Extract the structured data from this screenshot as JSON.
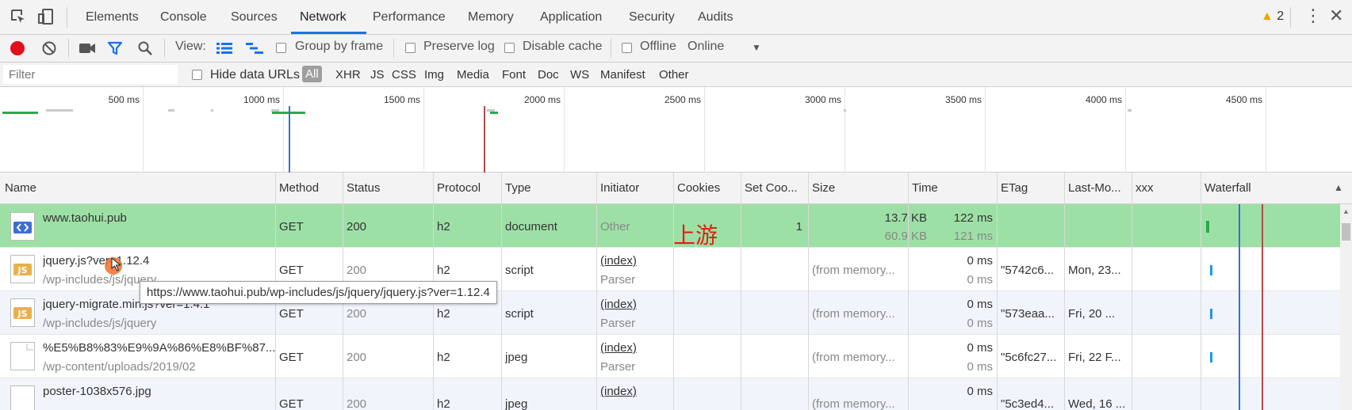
{
  "tabs": [
    "Elements",
    "Console",
    "Sources",
    "Network",
    "Performance",
    "Memory",
    "Application",
    "Security",
    "Audits"
  ],
  "active_tab": "Network",
  "warnings": {
    "count": "2"
  },
  "toolbar": {
    "view_label": "View:",
    "group_by_frame": "Group by frame",
    "preserve_log": "Preserve log",
    "disable_cache": "Disable cache",
    "offline": "Offline",
    "throttle": "Online"
  },
  "filter": {
    "placeholder": "Filter",
    "hide_data_urls": "Hide data URLs",
    "types": [
      "All",
      "XHR",
      "JS",
      "CSS",
      "Img",
      "Media",
      "Font",
      "Doc",
      "WS",
      "Manifest",
      "Other"
    ],
    "selected_type": "All"
  },
  "overview": {
    "ticks": [
      "500 ms",
      "1000 ms",
      "1500 ms",
      "2000 ms",
      "2500 ms",
      "3000 ms",
      "3500 ms",
      "4000 ms",
      "4500 ms"
    ]
  },
  "columns": [
    "Name",
    "Method",
    "Status",
    "Protocol",
    "Type",
    "Initiator",
    "Cookies",
    "Set Coo...",
    "Size",
    "Time",
    "ETag",
    "Last-Mo...",
    "xxx",
    "Waterfall"
  ],
  "rows": [
    {
      "name": "www.taohui.pub",
      "path": "",
      "method": "GET",
      "status": "200",
      "protocol": "h2",
      "type": "document",
      "initiator": "Other",
      "initiator_sub": "",
      "cookies": "上游",
      "set_cookies": "1",
      "size": "13.7 KB",
      "size_sub": "60.9 KB",
      "time": "122 ms",
      "time_sub": "121 ms",
      "etag": "",
      "last_modified": "",
      "xxx": ""
    },
    {
      "name": "jquery.js?ver=1.12.4",
      "path": "/wp-includes/js/jquery",
      "method": "GET",
      "status": "200",
      "protocol": "h2",
      "type": "script",
      "initiator": "(index)",
      "initiator_sub": "Parser",
      "cookies": "",
      "set_cookies": "",
      "size": "(from memory...",
      "size_sub": "",
      "time": "0 ms",
      "time_sub": "0 ms",
      "etag": "\"5742c6...",
      "last_modified": "Mon, 23...",
      "xxx": ""
    },
    {
      "name": "jquery-migrate.min.js?ver=1.4.1",
      "path": "/wp-includes/js/jquery",
      "method": "GET",
      "status": "200",
      "protocol": "h2",
      "type": "script",
      "initiator": "(index)",
      "initiator_sub": "Parser",
      "cookies": "",
      "set_cookies": "",
      "size": "(from memory...",
      "size_sub": "",
      "time": "0 ms",
      "time_sub": "0 ms",
      "etag": "\"573eaa...",
      "last_modified": "Fri, 20 ...",
      "xxx": ""
    },
    {
      "name": "%E5%B8%83%E9%9A%86%E8%BF%87...",
      "path": "/wp-content/uploads/2019/02",
      "method": "GET",
      "status": "200",
      "protocol": "h2",
      "type": "jpeg",
      "initiator": "(index)",
      "initiator_sub": "Parser",
      "cookies": "",
      "set_cookies": "",
      "size": "(from memory...",
      "size_sub": "",
      "time": "0 ms",
      "time_sub": "0 ms",
      "etag": "\"5c6fc27...",
      "last_modified": "Fri, 22 F...",
      "xxx": ""
    },
    {
      "name": "poster-1038x576.jpg",
      "path": "",
      "method": "GET",
      "status": "200",
      "protocol": "h2",
      "type": "jpeg",
      "initiator": "(index)",
      "initiator_sub": "",
      "cookies": "",
      "set_cookies": "",
      "size": "(from memory...",
      "size_sub": "",
      "time": "0 ms",
      "time_sub": "",
      "etag": "\"5c3ed4...",
      "last_modified": "Wed, 16 ...",
      "xxx": ""
    }
  ],
  "tooltip": "https://www.taohui.pub/wp-includes/js/jquery/jquery.js?ver=1.12.4",
  "colors": {
    "selected_row": "#9de0a6",
    "record": "#e0101e",
    "accent": "#1a73e8",
    "cookie_text": "#e02010",
    "warning": "#f0a400"
  }
}
